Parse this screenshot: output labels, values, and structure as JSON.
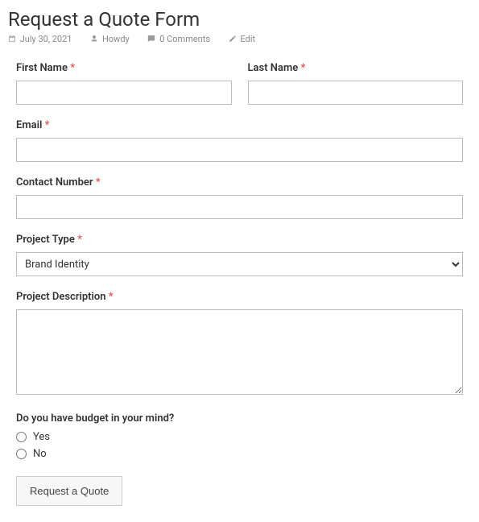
{
  "header": {
    "title": "Request a Quote Form",
    "date": "July 30, 2021",
    "author": "Howdy",
    "comments": "0 Comments",
    "edit": "Edit"
  },
  "form": {
    "first_name": {
      "label": "First Name",
      "value": ""
    },
    "last_name": {
      "label": "Last Name",
      "value": ""
    },
    "email": {
      "label": "Email",
      "value": ""
    },
    "contact_number": {
      "label": "Contact Number",
      "value": ""
    },
    "project_type": {
      "label": "Project Type",
      "selected": "Brand Identity",
      "options": [
        "Brand Identity"
      ]
    },
    "project_description": {
      "label": "Project Description",
      "value": ""
    },
    "budget": {
      "label": "Do you have budget in your mind?",
      "options": [
        "Yes",
        "No"
      ],
      "selected": null
    },
    "submit_label": "Request a Quote"
  },
  "required_marker": "*"
}
